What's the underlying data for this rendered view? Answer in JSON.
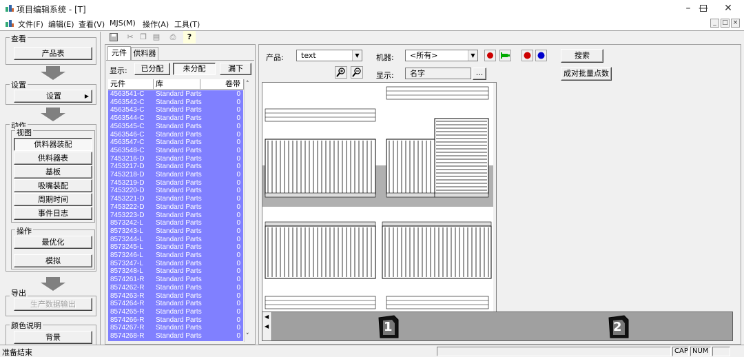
{
  "window": {
    "title": "项目编辑系统 - [T]"
  },
  "menu": {
    "items": [
      "文件(F)",
      "编辑(E)",
      "查看(V)",
      "MJS(M)",
      "操作(A)",
      "工具(T)"
    ]
  },
  "nav": {
    "view_group": "查看",
    "product_table": "产品表",
    "settings_group": "设置",
    "settings": "设置",
    "action_group": "动作",
    "view_subgroup": "视图",
    "view_items": [
      "供料器装配",
      "供料器表",
      "基板",
      "吸嘴装配",
      "周期时间",
      "事件日志"
    ],
    "operation_subgroup": "操作",
    "optimize": "最优化",
    "simulate": "模拟",
    "export_group": "导出",
    "export_data": "生产数据输出",
    "color_group": "颜色说明",
    "background": "背景"
  },
  "parts_panel": {
    "tabs": [
      "元件",
      "供料器"
    ],
    "display_label": "显示:",
    "filter_buttons": [
      "已分配",
      "未分配",
      "漏下"
    ],
    "columns": [
      "元件",
      "库",
      "卷带"
    ],
    "rows": [
      [
        "4563541-C",
        "Standard Parts",
        "0"
      ],
      [
        "4563542-C",
        "Standard Parts",
        "0"
      ],
      [
        "4563543-C",
        "Standard Parts",
        "0"
      ],
      [
        "4563544-C",
        "Standard Parts",
        "0"
      ],
      [
        "4563545-C",
        "Standard Parts",
        "0"
      ],
      [
        "4563546-C",
        "Standard Parts",
        "0"
      ],
      [
        "4563547-C",
        "Standard Parts",
        "0"
      ],
      [
        "4563548-C",
        "Standard Parts",
        "0"
      ],
      [
        "7453216-D",
        "Standard Parts",
        "0"
      ],
      [
        "7453217-D",
        "Standard Parts",
        "0"
      ],
      [
        "7453218-D",
        "Standard Parts",
        "0"
      ],
      [
        "7453219-D",
        "Standard Parts",
        "0"
      ],
      [
        "7453220-D",
        "Standard Parts",
        "0"
      ],
      [
        "7453221-D",
        "Standard Parts",
        "0"
      ],
      [
        "7453222-D",
        "Standard Parts",
        "0"
      ],
      [
        "7453223-D",
        "Standard Parts",
        "0"
      ],
      [
        "8573242-L",
        "Standard Parts",
        "0"
      ],
      [
        "8573243-L",
        "Standard Parts",
        "0"
      ],
      [
        "8573244-L",
        "Standard Parts",
        "0"
      ],
      [
        "8573245-L",
        "Standard Parts",
        "0"
      ],
      [
        "8573246-L",
        "Standard Parts",
        "0"
      ],
      [
        "8573247-L",
        "Standard Parts",
        "0"
      ],
      [
        "8573248-L",
        "Standard Parts",
        "0"
      ],
      [
        "8574261-R",
        "Standard Parts",
        "0"
      ],
      [
        "8574262-R",
        "Standard Parts",
        "0"
      ],
      [
        "8574263-R",
        "Standard Parts",
        "0"
      ],
      [
        "8574264-R",
        "Standard Parts",
        "0"
      ],
      [
        "8574265-R",
        "Standard Parts",
        "0"
      ],
      [
        "8574266-R",
        "Standard Parts",
        "0"
      ],
      [
        "8574267-R",
        "Standard Parts",
        "0"
      ],
      [
        "8574268-R",
        "Standard Parts",
        "0"
      ]
    ]
  },
  "right_panel": {
    "product_label": "产品:",
    "product_value": "text",
    "machine_label": "机器:",
    "machine_value": "<所有>",
    "search_button": "搜索",
    "display_label": "显示:",
    "display_value": "名字",
    "browse_button": "...",
    "batch_button": "成对批量点数",
    "machine_tabs": [
      "1",
      "2"
    ],
    "colors": {
      "red_dot": "#cc0000",
      "blue_dot": "#0000cc",
      "selected_row": "#8080ff"
    },
    "icons": [
      "zoom-in-icon",
      "zoom-out-icon",
      "red-marker-icon",
      "green-pin-icon",
      "red-circle-icon",
      "blue-circle-icon"
    ]
  },
  "status": {
    "text": "准备结束",
    "cap": "CAP",
    "num": "NUM"
  }
}
